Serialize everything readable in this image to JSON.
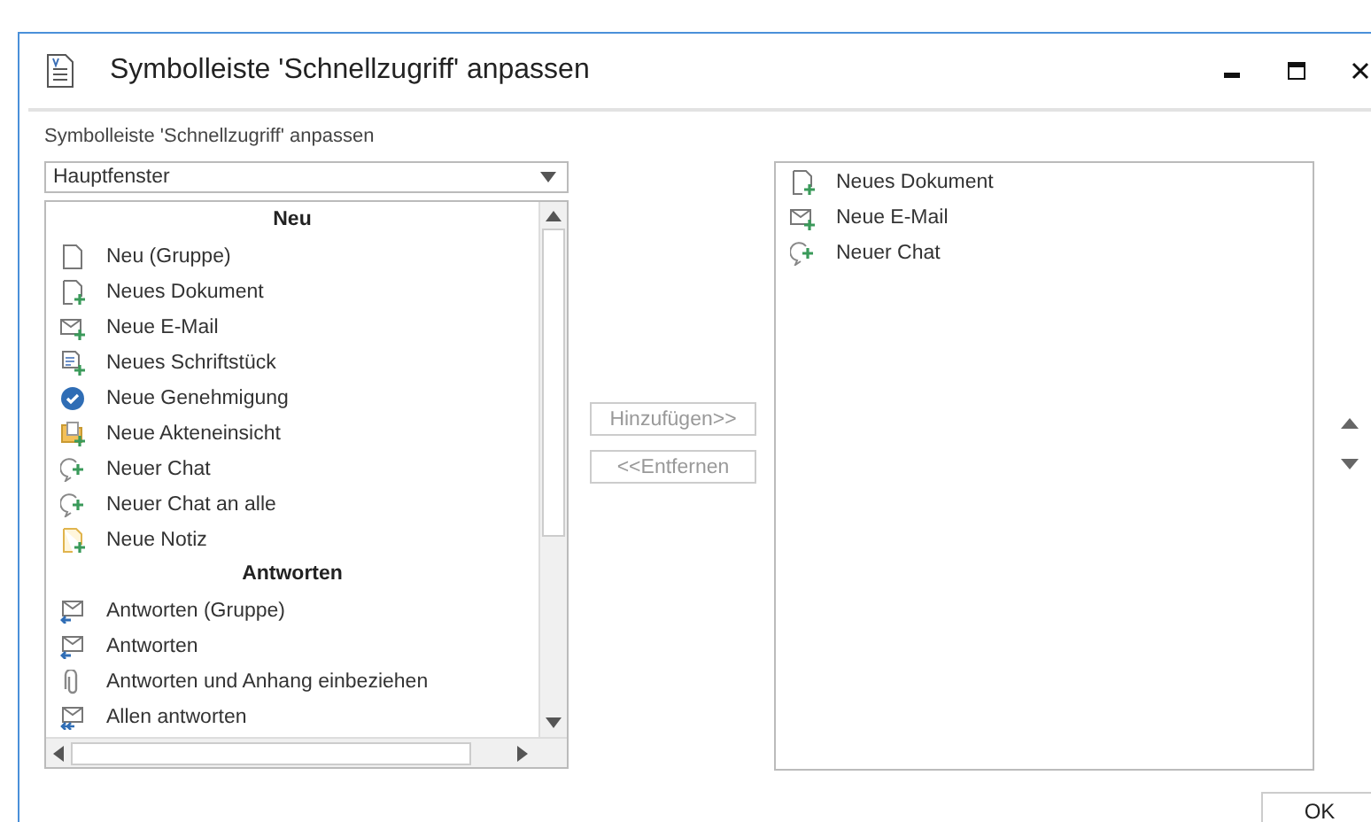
{
  "window": {
    "title": "Symbolleiste 'Schnellzugriff' anpassen"
  },
  "subtitle": "Symbolleiste 'Schnellzugriff' anpassen",
  "dropdown": {
    "value": "Hauptfenster"
  },
  "available": [
    {
      "kind": "header",
      "label": "Neu"
    },
    {
      "kind": "doc",
      "label": "Neu (Gruppe)"
    },
    {
      "kind": "doc-plus",
      "label": "Neues Dokument"
    },
    {
      "kind": "mail-plus",
      "label": "Neue E-Mail"
    },
    {
      "kind": "text-plus",
      "label": "Neues Schriftstück"
    },
    {
      "kind": "check",
      "label": "Neue Genehmigung"
    },
    {
      "kind": "folder-plus",
      "label": "Neue Akteneinsicht"
    },
    {
      "kind": "chat-plus",
      "label": "Neuer Chat"
    },
    {
      "kind": "chat-plus",
      "label": "Neuer Chat an alle"
    },
    {
      "kind": "note-plus",
      "label": "Neue Notiz"
    },
    {
      "kind": "header",
      "label": "Antworten"
    },
    {
      "kind": "mail-reply",
      "label": "Antworten (Gruppe)"
    },
    {
      "kind": "mail-reply",
      "label": "Antworten"
    },
    {
      "kind": "clip",
      "label": "Antworten und Anhang einbeziehen"
    },
    {
      "kind": "mail-reply-all",
      "label": "Allen antworten"
    }
  ],
  "buttons": [
    {
      "label": "Hinzufügen>>",
      "disabled": true
    },
    {
      "label": "<<Entfernen",
      "disabled": true
    }
  ],
  "selected": [
    {
      "kind": "doc-plus",
      "label": "Neues Dokument"
    },
    {
      "kind": "mail-plus",
      "label": "Neue E-Mail"
    },
    {
      "kind": "chat-plus",
      "label": "Neuer Chat"
    }
  ],
  "ok_button": "OK"
}
